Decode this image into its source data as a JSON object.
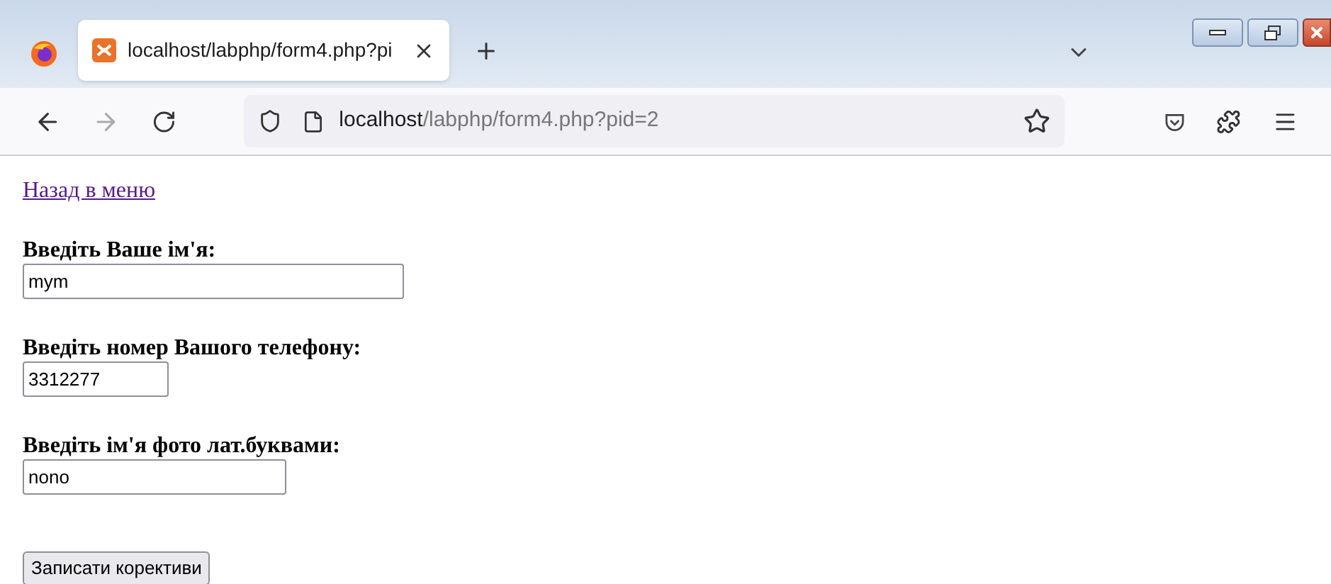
{
  "tab": {
    "title": "localhost/labphp/form4.php?pi",
    "selected": true
  },
  "address": {
    "host": "localhost",
    "path": "/labphp/form4.php?pid=2"
  },
  "link": "Назад в меню",
  "fields": [
    {
      "label": "Введіть Ваше ім'я:",
      "value": "mym"
    },
    {
      "label": "Введіть номер Вашого телефону:",
      "value": "3312277"
    },
    {
      "label": "Введіть ім'я фото лат.буквами:",
      "value": "nono"
    }
  ],
  "submit": "Записати корективи"
}
